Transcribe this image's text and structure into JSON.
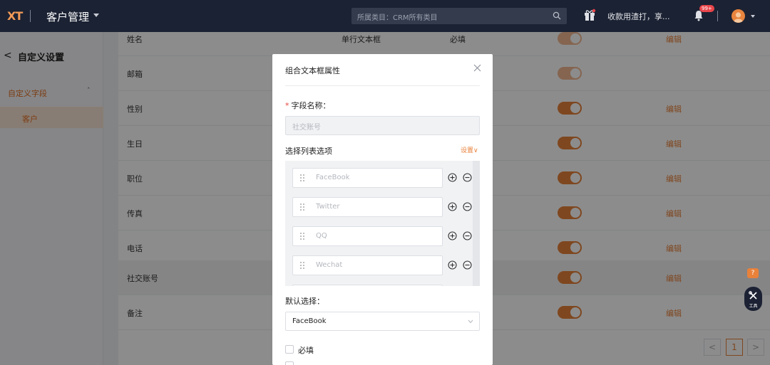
{
  "topbar": {
    "logo": "XT",
    "app_title": "客户管理",
    "search_placeholder": "所属类目：CRM所有类目",
    "notice": "收款用渣打，享...",
    "bell_badge": "99+"
  },
  "sidebar": {
    "back_icon": "chevron-left-icon",
    "title": "自定义设置",
    "group_label": "自定义字段",
    "group_chevron": "ˆ",
    "item_label": "客户"
  },
  "table": {
    "rows": [
      {
        "name": "姓名",
        "type": "单行文本框",
        "required": "必填",
        "toggle": "dim",
        "edit": "编辑"
      },
      {
        "name": "邮箱",
        "type": "",
        "required": "",
        "toggle": "dim",
        "edit": ""
      },
      {
        "name": "性别",
        "type": "",
        "required": "",
        "toggle": "on",
        "edit": "编辑"
      },
      {
        "name": "生日",
        "type": "",
        "required": "",
        "toggle": "on",
        "edit": "编辑"
      },
      {
        "name": "职位",
        "type": "",
        "required": "",
        "toggle": "on",
        "edit": "编辑"
      },
      {
        "name": "传真",
        "type": "",
        "required": "",
        "toggle": "on",
        "edit": "编辑"
      },
      {
        "name": "电话",
        "type": "",
        "required": "",
        "toggle": "on",
        "edit": "编辑"
      },
      {
        "name": "社交账号",
        "type": "",
        "required": "",
        "toggle": "on",
        "edit": "编辑"
      },
      {
        "name": "备注",
        "type": "",
        "required": "",
        "toggle": "on",
        "edit": "编辑"
      }
    ],
    "pager": {
      "prev": "<",
      "current": "1",
      "next": ">"
    }
  },
  "modal": {
    "title": "组合文本框属性",
    "field_star": "*",
    "field_label": "字段名称：",
    "field_placeholder": "社交账号",
    "options_label": "选择列表选项",
    "settings_link": "设置∨",
    "options": [
      "FaceBook",
      "Twitter",
      "QQ",
      "Wechat"
    ],
    "default_label": "默认选择：",
    "default_value": "FaceBook",
    "required_label": "必填"
  },
  "widgets": {
    "help": "?",
    "tools_label": "工具"
  },
  "colors": {
    "accent": "#e8813a",
    "topbar": "#1b2233",
    "sidebar_active": "#f8e4d3"
  }
}
